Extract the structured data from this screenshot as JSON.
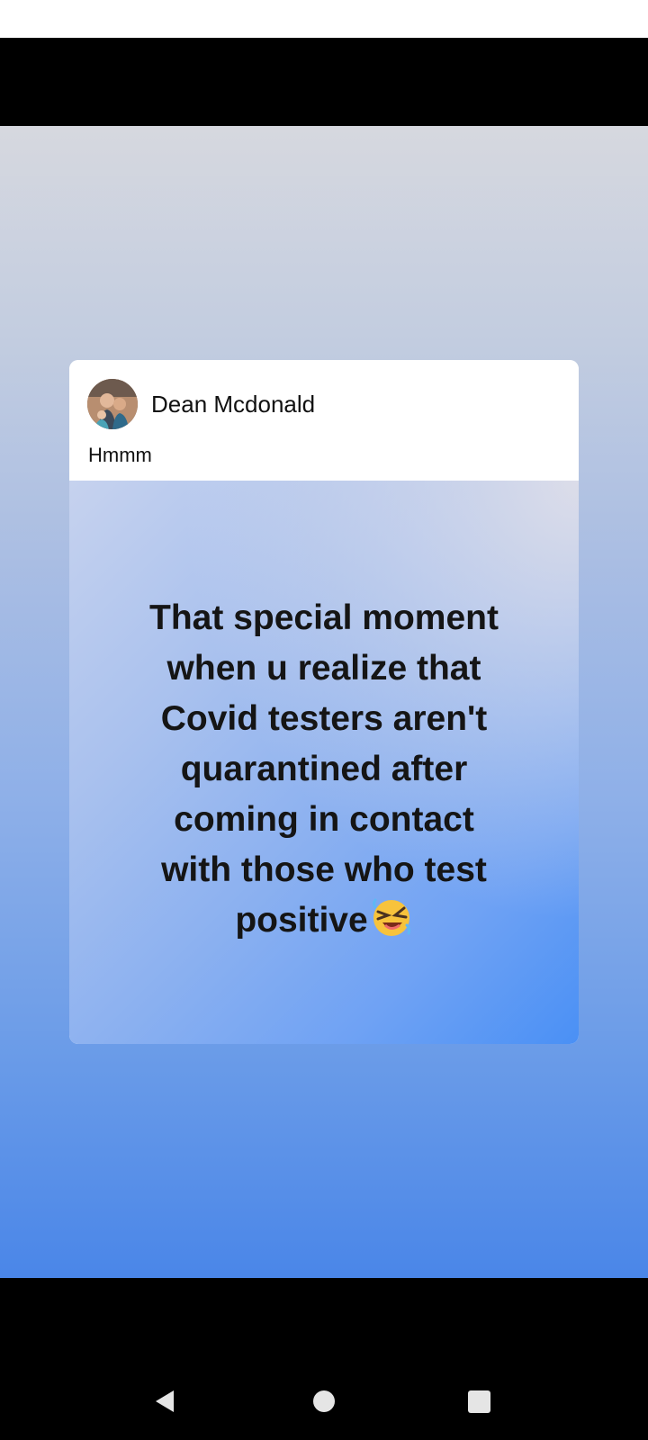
{
  "post": {
    "author": "Dean Mcdonald",
    "caption": "Hmmm",
    "image_text_lines": [
      "That special moment",
      "when u  realize that",
      "Covid testers aren't",
      "quarantined after",
      "coming in contact",
      "with those who test",
      "positive"
    ],
    "image_emoji": "rolling-on-the-floor-laughing-emoji"
  },
  "navigation": {
    "buttons": [
      "back-icon",
      "home-icon",
      "recents-icon"
    ]
  },
  "colors": {
    "background_top": "#d6d8df",
    "background_bottom": "#4a86e8",
    "card": "#ffffff",
    "meme_text": "#151515",
    "system_bars": "#000000"
  }
}
